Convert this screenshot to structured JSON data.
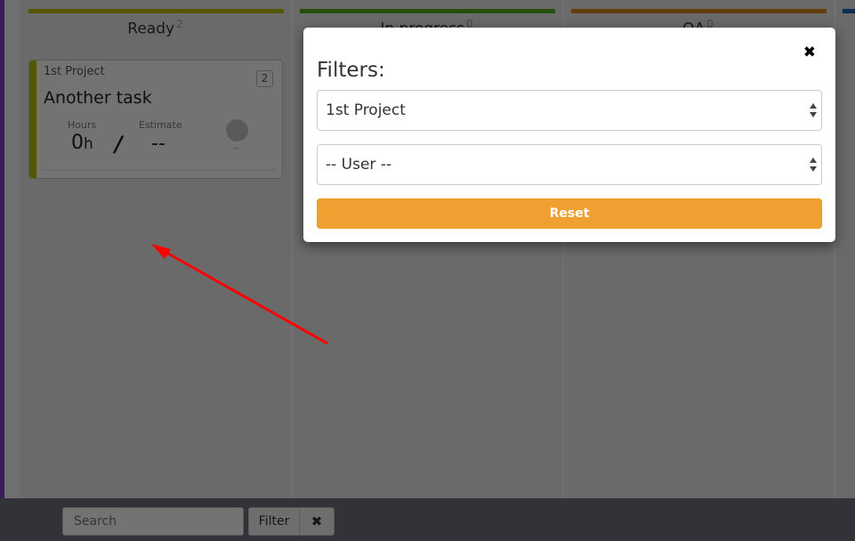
{
  "board": {
    "columns": [
      {
        "name": "Ready",
        "count": "2",
        "color": "#bcbf00"
      },
      {
        "name": "In progress",
        "count": "0",
        "color": "#4caf1a"
      },
      {
        "name": "QA",
        "count": "0",
        "color": "#e08a1e"
      },
      {
        "name": "",
        "count": "",
        "color": "#1e5fb8"
      }
    ],
    "card": {
      "project": "1st Project",
      "title": "Another task",
      "badge": "2",
      "hours_label": "Hours",
      "hours_value": "0",
      "hours_unit": "h",
      "separator": "/",
      "estimate_label": "Estimate",
      "estimate_value": "--",
      "assignee": "--"
    }
  },
  "footer": {
    "search_placeholder": "Search",
    "filter_label": "Filter",
    "clear_icon": "✖"
  },
  "modal": {
    "title": "Filters:",
    "close_icon": "✖",
    "project_select": "1st Project",
    "user_select": "-- User --",
    "reset_label": "Reset"
  },
  "annotation": {
    "type": "red-arrow",
    "color": "#ff0000"
  }
}
